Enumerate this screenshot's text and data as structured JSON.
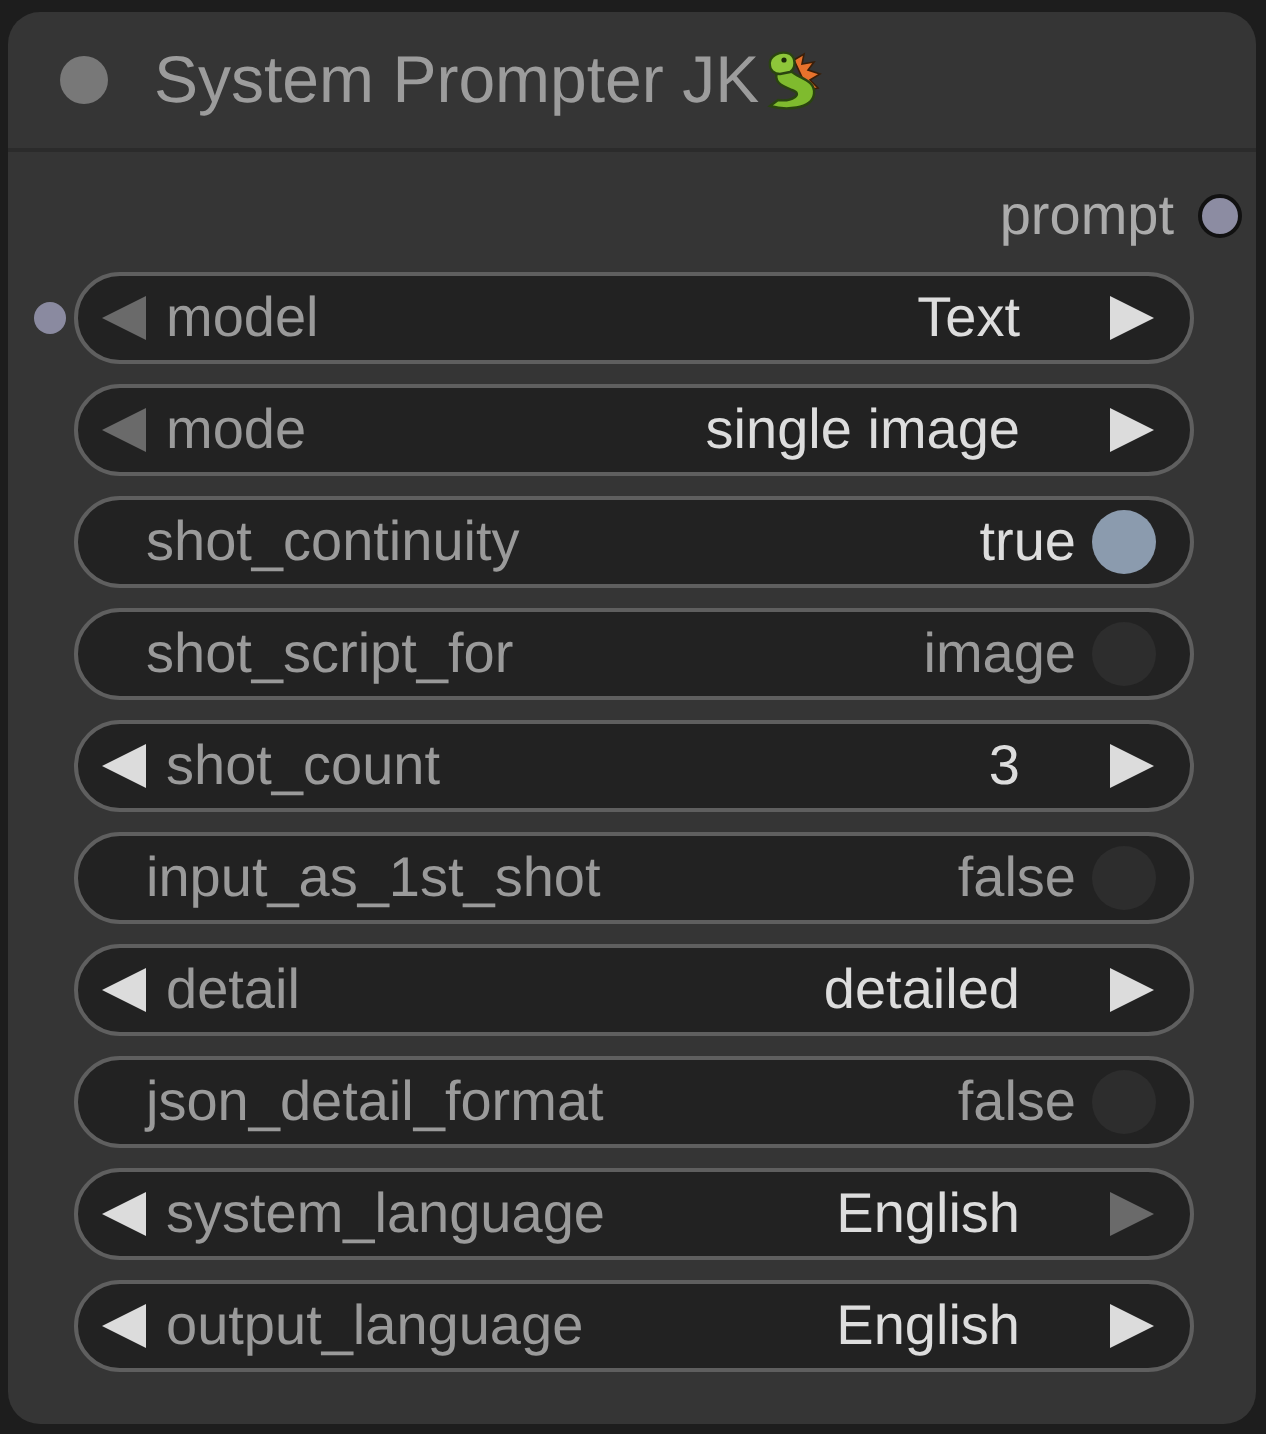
{
  "node": {
    "title": "System Prompter JK",
    "outputs": [
      {
        "name": "prompt"
      }
    ],
    "widgets": [
      {
        "kind": "combo",
        "label": "model",
        "value": "Text",
        "has_input": true,
        "prev_enabled": false,
        "next_enabled": true
      },
      {
        "kind": "combo",
        "label": "mode",
        "value": "single image",
        "has_input": false,
        "prev_enabled": false,
        "next_enabled": true
      },
      {
        "kind": "toggle",
        "label": "shot_continuity",
        "value": "true",
        "on": true,
        "has_input": false
      },
      {
        "kind": "toggle",
        "label": "shot_script_for",
        "value": "image",
        "on": false,
        "has_input": false
      },
      {
        "kind": "number",
        "label": "shot_count",
        "value": "3",
        "has_input": false,
        "prev_enabled": true,
        "next_enabled": true
      },
      {
        "kind": "toggle",
        "label": "input_as_1st_shot",
        "value": "false",
        "on": false,
        "has_input": false
      },
      {
        "kind": "combo",
        "label": "detail",
        "value": "detailed",
        "has_input": false,
        "prev_enabled": true,
        "next_enabled": true
      },
      {
        "kind": "toggle",
        "label": "json_detail_format",
        "value": "false",
        "on": false,
        "has_input": false
      },
      {
        "kind": "combo",
        "label": "system_language",
        "value": "English",
        "has_input": false,
        "prev_enabled": true,
        "next_enabled": false
      },
      {
        "kind": "combo",
        "label": "output_language",
        "value": "English",
        "has_input": false,
        "prev_enabled": true,
        "next_enabled": true
      }
    ]
  }
}
